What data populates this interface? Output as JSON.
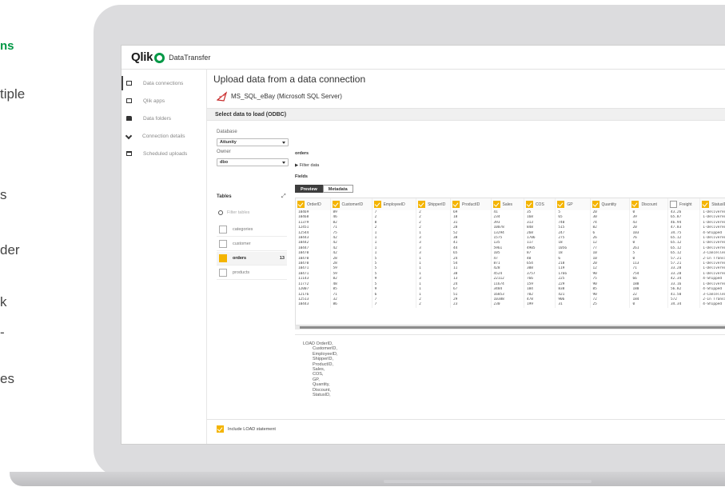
{
  "marketing": {
    "fragments": [
      "ns",
      "tiple",
      "s",
      "der",
      "k",
      "-",
      "es"
    ]
  },
  "app": {
    "logo": "Qlik",
    "name": "DataTransfer"
  },
  "sidebar": {
    "items": [
      {
        "label": "Data connections",
        "icon": "grid-icon",
        "active": true
      },
      {
        "label": "Qlik apps",
        "icon": "app-icon",
        "active": false
      },
      {
        "label": "Data folders",
        "icon": "folder-icon",
        "active": false
      },
      {
        "label": "Connection details",
        "icon": "plug-icon",
        "active": false
      },
      {
        "label": "Scheduled uploads",
        "icon": "calendar-icon",
        "active": false
      }
    ]
  },
  "main": {
    "title": "Upload data from a data connection",
    "connection_name": "MS_SQL_eBay (Microsoft SQL Server)",
    "section_title": "Select data to load (ODBC)",
    "database_label": "Database",
    "database_value": "Attunity",
    "owner_label": "Owner",
    "owner_value": "dbo",
    "tables_label": "Tables",
    "filter_placeholder": "Filter tables",
    "tables": [
      {
        "name": "categories",
        "selected": false,
        "count": ""
      },
      {
        "name": "customer",
        "selected": false,
        "count": ""
      },
      {
        "name": "orders",
        "selected": true,
        "count": "13"
      },
      {
        "name": "products",
        "selected": false,
        "count": ""
      }
    ],
    "current_table": "orders",
    "filter_data": "Filter data",
    "fields_label": "Fields",
    "tab_preview": "Preview",
    "tab_metadata": "Metadata",
    "columns": [
      {
        "name": "OrderID",
        "checked": true
      },
      {
        "name": "CustomerID",
        "checked": true
      },
      {
        "name": "EmployeeID",
        "checked": true
      },
      {
        "name": "ShipperID",
        "checked": true
      },
      {
        "name": "ProductID",
        "checked": true
      },
      {
        "name": "Sales",
        "checked": true
      },
      {
        "name": "COS",
        "checked": true
      },
      {
        "name": "GP",
        "checked": true
      },
      {
        "name": "Quantity",
        "checked": true
      },
      {
        "name": "Discount",
        "checked": true
      },
      {
        "name": "Freight",
        "checked": false
      },
      {
        "name": "StatusID",
        "checked": true
      }
    ],
    "rows": [
      [
        "10469",
        "89",
        "7",
        "2",
        "69",
        "41",
        "35",
        "5",
        "20",
        "0",
        "43.26",
        "1-Delivered"
      ],
      [
        "10468",
        "46",
        "2",
        "2",
        "18",
        "234",
        "168",
        "65",
        "30",
        "39",
        "65.87",
        "1-Delivered"
      ],
      [
        "11379",
        "82",
        "8",
        "2",
        "31",
        "393",
        "313",
        "740",
        "74",
        "43",
        "46.94",
        "1-Delivered"
      ],
      [
        "12451",
        "71",
        "2",
        "2",
        "28",
        "10078",
        "848",
        "515",
        "82",
        "20",
        "47.83",
        "1-Delivered"
      ],
      [
        "12544",
        "75",
        "1",
        "1",
        "52",
        "13294",
        "268",
        "247",
        "6",
        "103",
        "34.75",
        "4-Shipped"
      ],
      [
        "10443",
        "42",
        "1",
        "3",
        "38",
        "1575",
        "1706",
        "275",
        "26",
        "76",
        "65.12",
        "1-Delivered"
      ],
      [
        "10442",
        "42",
        "1",
        "3",
        "41",
        "135",
        "117",
        "18",
        "12",
        "0",
        "65.12",
        "1-Delivered"
      ],
      [
        "10447",
        "42",
        "1",
        "3",
        "44",
        "5961",
        "4905",
        "1056",
        "77",
        "261",
        "65.12",
        "1-Delivered"
      ],
      [
        "10470",
        "42",
        "1",
        "3",
        "65",
        "105",
        "87",
        "18",
        "10",
        "5",
        "65.12",
        "3-Cancelled"
      ],
      [
        "10470",
        "28",
        "5",
        "1",
        "24",
        "47",
        "40",
        "6",
        "10",
        "0",
        "57.21",
        "2-In Transit"
      ],
      [
        "10470",
        "28",
        "5",
        "1",
        "54",
        "871",
        "654",
        "218",
        "20",
        "113",
        "57.21",
        "1-Delivered"
      ],
      [
        "10471",
        "59",
        "5",
        "1",
        "11",
        "428",
        "308",
        "119",
        "12",
        "71",
        "33.28",
        "1-Delivered"
      ],
      [
        "10471",
        "59",
        "5",
        "1",
        "38",
        "4524",
        "3757",
        "1766",
        "90",
        "754",
        "33.28",
        "1-Delivered"
      ],
      [
        "11143",
        "82",
        "9",
        "3",
        "13",
        "22112",
        "766",
        "225",
        "75",
        "66",
        "42.34",
        "4-Shipped"
      ],
      [
        "11772",
        "48",
        "5",
        "1",
        "24",
        "11674",
        "159",
        "229",
        "90",
        "188",
        "33.16",
        "1-Delivered"
      ],
      [
        "12007",
        "85",
        "9",
        "1",
        "67",
        "3484",
        "184",
        "838",
        "85",
        "180",
        "56.82",
        "4-Shipped"
      ],
      [
        "12176",
        "71",
        "6",
        "1",
        "51",
        "16853",
        "702",
        "421",
        "90",
        "22",
        "41.50",
        "3-Cancelled"
      ],
      [
        "12513",
        "32",
        "7",
        "2",
        "29",
        "10388",
        "478",
        "906",
        "72",
        "184",
        "572",
        "2-In Transit"
      ],
      [
        "10443",
        "86",
        "7",
        "2",
        "23",
        "230",
        "199",
        "31",
        "25",
        "0",
        "34.34",
        "4-Shipped"
      ]
    ],
    "script_lines": [
      "LOAD OrderID,",
      "CustomerID,",
      "EmployeeID,",
      "ShipperID,",
      "ProductID,",
      "Sales,",
      "COS,",
      "GP,",
      "Quantity,",
      "Discount,",
      "StatusID,"
    ],
    "include_load": "Include LOAD statement"
  },
  "colors": {
    "accent": "#f4b400",
    "brand": "#009845",
    "dark": "#3d3d3d"
  }
}
